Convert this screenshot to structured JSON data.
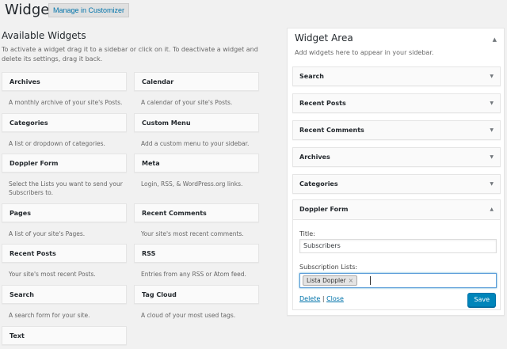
{
  "header": {
    "title": "Widgets",
    "manage_label": "Manage in Customizer"
  },
  "available": {
    "title": "Available Widgets",
    "description": "To activate a widget drag it to a sidebar or click on it. To deactivate a widget and delete its settings, drag it back.",
    "widgets": [
      {
        "name": "Archives",
        "desc": "A monthly archive of your site's Posts."
      },
      {
        "name": "Calendar",
        "desc": "A calendar of your site's Posts."
      },
      {
        "name": "Categories",
        "desc": "A list or dropdown of categories."
      },
      {
        "name": "Custom Menu",
        "desc": "Add a custom menu to your sidebar."
      },
      {
        "name": "Doppler Form",
        "desc": "Select the Lists you want to send your Subscribers to."
      },
      {
        "name": "Meta",
        "desc": "Login, RSS, & WordPress.org links."
      },
      {
        "name": "Pages",
        "desc": "A list of your site's Pages."
      },
      {
        "name": "Recent Comments",
        "desc": "Your site's most recent comments."
      },
      {
        "name": "Recent Posts",
        "desc": "Your site's most recent Posts."
      },
      {
        "name": "RSS",
        "desc": "Entries from any RSS or Atom feed."
      },
      {
        "name": "Search",
        "desc": "A search form for your site."
      },
      {
        "name": "Tag Cloud",
        "desc": "A cloud of your most used tags."
      },
      {
        "name": "Text",
        "desc": ""
      }
    ]
  },
  "area": {
    "title": "Widget Area",
    "description": "Add widgets here to appear in your sidebar.",
    "widgets": [
      "Search",
      "Recent Posts",
      "Recent Comments",
      "Archives",
      "Categories"
    ],
    "open_widget": {
      "name": "Doppler Form",
      "title_label": "Title:",
      "title_value": "Subscribers",
      "lists_label": "Subscription Lists:",
      "selected_list": "Lista Doppler",
      "chip_remove": "×",
      "delete_label": "Delete",
      "separator": "|",
      "close_label": "Close",
      "save_label": "Save"
    }
  },
  "colors": {
    "accent": "#0073aa",
    "button": "#0085ba"
  }
}
